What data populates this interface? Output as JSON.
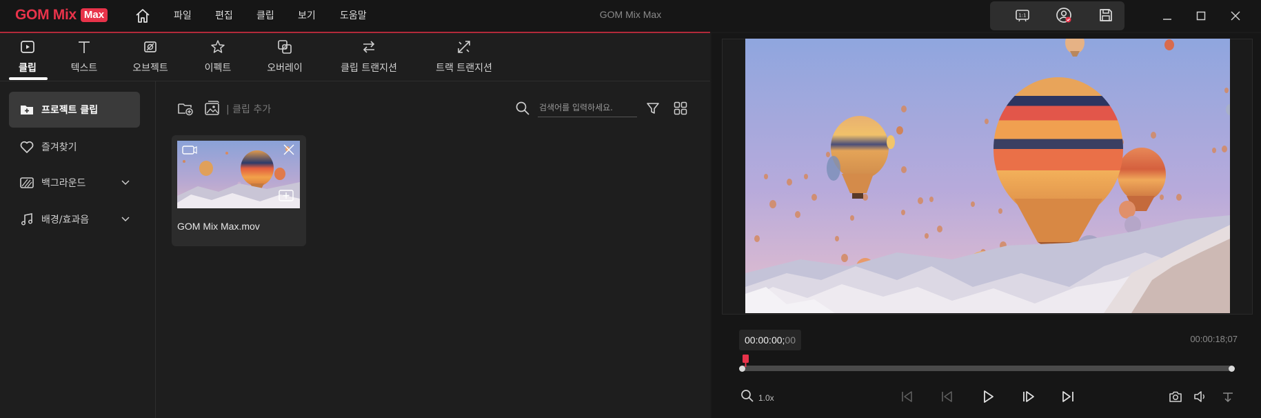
{
  "app": {
    "title": "GOM Mix Max",
    "logo_text": "GOM Mix",
    "logo_badge": "Max",
    "brand_color": "#e8334a"
  },
  "menu": {
    "items": [
      {
        "label": "파일"
      },
      {
        "label": "편집"
      },
      {
        "label": "클립"
      },
      {
        "label": "보기"
      },
      {
        "label": "도움말"
      }
    ]
  },
  "toolbar_right": {
    "icons": [
      "aspect-ratio-icon",
      "account-icon",
      "save-icon"
    ],
    "aspect_label": "1:1"
  },
  "window_controls": [
    "minimize-icon",
    "maximize-icon",
    "close-icon"
  ],
  "tabs": [
    {
      "label": "클립",
      "icon": "clip-icon",
      "active": true
    },
    {
      "label": "텍스트",
      "icon": "text-icon",
      "active": false
    },
    {
      "label": "오브젝트",
      "icon": "object-icon",
      "active": false
    },
    {
      "label": "이펙트",
      "icon": "effect-icon",
      "active": false
    },
    {
      "label": "오버레이",
      "icon": "overlay-icon",
      "active": false
    },
    {
      "label": "클립 트랜지션",
      "icon": "clip-transition-icon",
      "active": false
    },
    {
      "label": "트랙 트랜지션",
      "icon": "track-transition-icon",
      "active": false
    }
  ],
  "sidebar": {
    "items": [
      {
        "label": "프로젝트 클립",
        "icon": "project-folder-icon",
        "active": true
      },
      {
        "label": "즐겨찾기",
        "icon": "heart-icon",
        "active": false
      },
      {
        "label": "백그라운드",
        "icon": "background-icon",
        "expandable": true
      },
      {
        "label": "배경/효과음",
        "icon": "music-icon",
        "expandable": true
      }
    ]
  },
  "clip_toolbar": {
    "add_clip_label": "| 클립 추가",
    "search_placeholder": "검색어를 입력하세요."
  },
  "clips": [
    {
      "name": "GOM Mix Max.mov"
    }
  ],
  "player": {
    "current_time": "00:00:00;",
    "current_frames": "00",
    "total_time": "00:00:18;07",
    "zoom": "1.0x",
    "position": 0,
    "accent_color": "#e8334a"
  }
}
